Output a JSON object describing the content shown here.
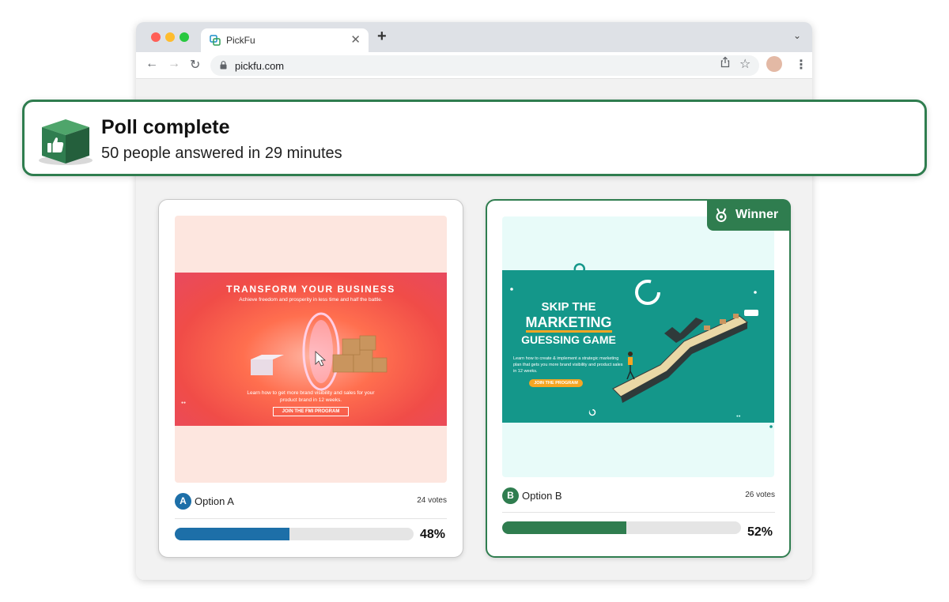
{
  "browser": {
    "tab_title": "PickFu",
    "url": "pickfu.com"
  },
  "banner": {
    "title": "Poll complete",
    "subtitle": "50 people answered in 29 minutes"
  },
  "options": [
    {
      "letter": "A",
      "label": "Option A",
      "votes": "24 votes",
      "percent_text": "48%",
      "percent": 48,
      "color": "#1d6fa8",
      "ad": {
        "title": "TRANSFORM YOUR BUSINESS",
        "subtitle": "Achieve freedom and prosperity in less time and half the battle.",
        "body": "Learn how to get more brand visibility and sales for your product brand in 12 weeks.",
        "cta": "JOIN THE FMI PROGRAM"
      }
    },
    {
      "letter": "B",
      "label": "Option B",
      "votes": "26 votes",
      "percent_text": "52%",
      "percent": 52,
      "color": "#2f7d4f",
      "winner_label": "Winner",
      "ad": {
        "line1": "SKIP THE",
        "line2": "MARKETING",
        "line3": "GUESSING GAME",
        "body": "Learn how to create & implement a strategic marketing plan that gets you more brand visibility and product sales in 12 weeks.",
        "cta": "JOIN THE PROGRAM"
      }
    }
  ],
  "colors": {
    "accent_green": "#2f7d4f",
    "accent_blue": "#1d6fa8"
  }
}
